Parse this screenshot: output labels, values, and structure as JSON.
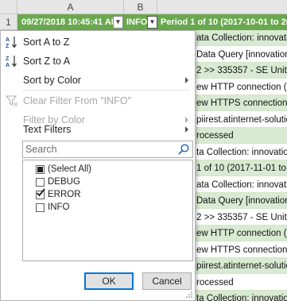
{
  "sheet": {
    "columns": [
      "A",
      "B"
    ],
    "row_number": "1",
    "header_cells": {
      "a": "09/27/2018 10:45:41 AM",
      "b": "INFO",
      "c": "Period 1 of 10 (2017-10-01 to 2017-"
    },
    "visible_cells": [
      {
        "text": "ata Collection: innovatio",
        "fill": "green"
      },
      {
        "text": "Data Query [innovation-",
        "fill": "white"
      },
      {
        "text": "2 >> 335357 - SE United S",
        "fill": "green"
      },
      {
        "text": "ew HTTP connection (1):",
        "fill": "white"
      },
      {
        "text": "ew HTTPS connection (1)",
        "fill": "green"
      },
      {
        "text": "piirest.atinternet-solution",
        "fill": "white"
      },
      {
        "text": "rocessed",
        "fill": "green"
      },
      {
        "text": "ta Collection: innovation",
        "fill": "white"
      },
      {
        "text": "1 of 10 (2017-11-01 to 2017-",
        "fill": "green"
      },
      {
        "text": "ata Collection: innovatio",
        "fill": "white"
      },
      {
        "text": "Data Query [innovation-",
        "fill": "green"
      },
      {
        "text": "2 >> 335357 - SE United S",
        "fill": "white"
      },
      {
        "text": "ew HTTP connection (1):",
        "fill": "green"
      },
      {
        "text": "ew HTTPS connection (1)",
        "fill": "white"
      },
      {
        "text": "piirest.atinternet-solution",
        "fill": "green"
      },
      {
        "text": "rocessed",
        "fill": "white"
      },
      {
        "text": "ta Collection: innovation",
        "fill": "green"
      }
    ]
  },
  "menu": {
    "sort_az": "Sort A to Z",
    "sort_za": "Sort Z to A",
    "sort_by_color": "Sort by Color",
    "clear_filter": "Clear Filter From \"INFO\"",
    "filter_by_color": "Filter by Color",
    "text_filters": "Text Filters",
    "search_placeholder": "Search",
    "items": [
      {
        "label": "(Select All)",
        "state": "partial"
      },
      {
        "label": "DEBUG",
        "state": "unchecked"
      },
      {
        "label": "ERROR",
        "state": "checked"
      },
      {
        "label": "INFO",
        "state": "unchecked"
      }
    ],
    "ok": "OK",
    "cancel": "Cancel"
  },
  "colors": {
    "header_green": "#6aa84f",
    "row_green": "#d9ead3",
    "ok_border": "#0078d7"
  }
}
